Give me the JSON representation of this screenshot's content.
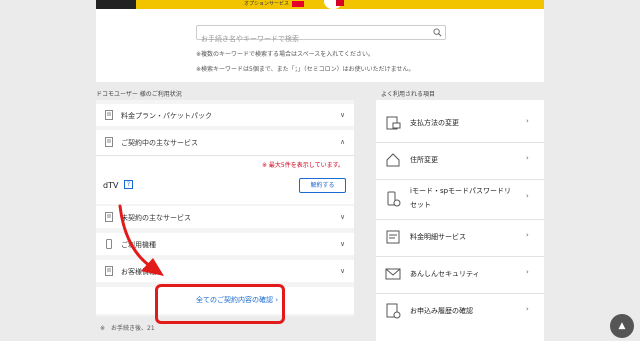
{
  "banner": {
    "service_text": "オプションサービス",
    "colors": {
      "yellow": "#f2c400",
      "red": "#d40028"
    }
  },
  "search": {
    "placeholder": "お手続き名やキーワードで検索",
    "note1": "※複数のキーワードで検索する場合はスペースを入れてください。",
    "note2": "※検索キーワードは5個まで、また「；」（セミコロン）はお使いいただけません。"
  },
  "left": {
    "title": "ドコモユーザー 様のご利用状況",
    "items": [
      {
        "label": "料金プラン・パケットパック",
        "chevron": "∨"
      },
      {
        "label": "ご契約中の主なサービス",
        "chevron": "∧"
      },
      {
        "label": "未契約の主なサービス",
        "chevron": "∨"
      },
      {
        "label": "ご利用機種",
        "chevron": "∨"
      },
      {
        "label": "お客様情報",
        "chevron": "∨"
      }
    ],
    "warning": "※ 最大5件を表示しています。",
    "service_name": "dTV",
    "help": "?",
    "cancel_button": "解約する",
    "confirm_link": "全てのご契約内容の確認",
    "confirm_chevron": "›",
    "footnote": "※　お手続き後、21"
  },
  "right": {
    "title": "よく利用される項目",
    "items": [
      {
        "label": "支払方法の変更",
        "icon": "payment-icon"
      },
      {
        "label": "住所変更",
        "icon": "home-icon"
      },
      {
        "label1": "iモード・spモードパスワードリ",
        "label2": "セット",
        "icon": "password-icon"
      },
      {
        "label": "料金明細サービス",
        "icon": "invoice-icon"
      },
      {
        "label": "あんしんセキュリティ",
        "icon": "security-icon"
      },
      {
        "label": "お申込み履歴の確認",
        "icon": "history-icon"
      }
    ],
    "chevron": "›"
  },
  "scroll_top": "▲",
  "accent": {
    "link": "#1a6ad3",
    "annotation": "#e21a1a"
  }
}
